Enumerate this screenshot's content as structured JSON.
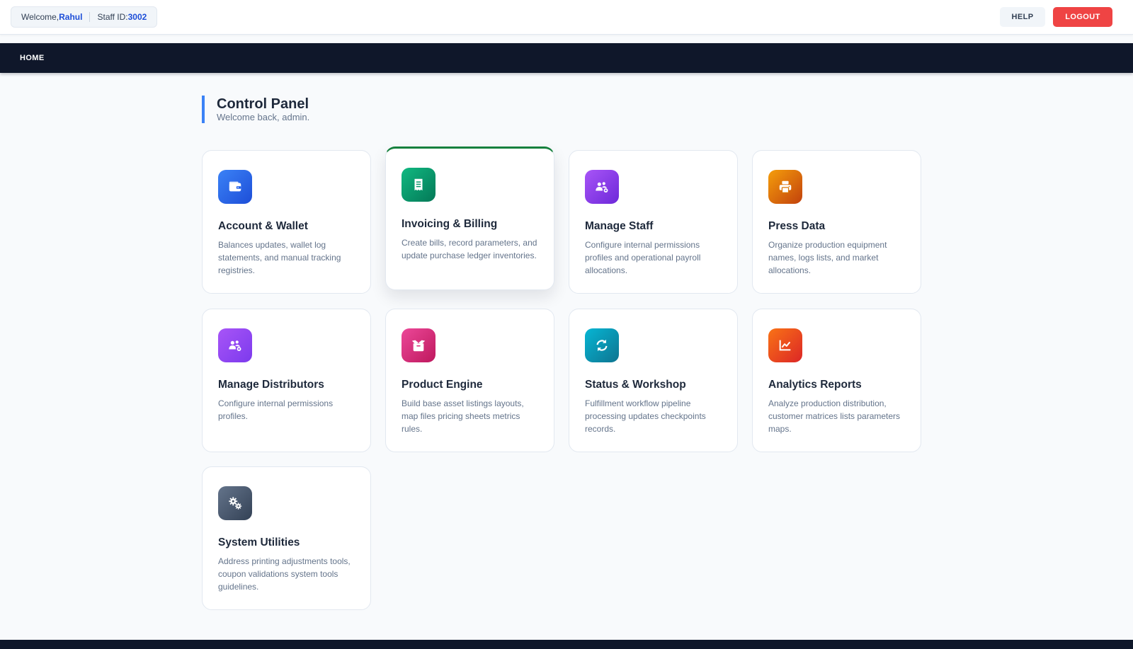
{
  "topbar": {
    "welcome_label": "Welcome, ",
    "user_name": "Rahul",
    "staff_label": "Staff ID: ",
    "staff_id": "3002",
    "help_label": "HELP",
    "logout_label": "LOGOUT"
  },
  "nav": {
    "home_label": "HOME"
  },
  "header": {
    "title": "Control Panel",
    "subtitle": "Welcome back, admin."
  },
  "cards": [
    {
      "title": "Account & Wallet",
      "desc": "Balances updates, wallet log statements, and manual tracking registries.",
      "icon": "wallet-icon",
      "color": "#2563eb"
    },
    {
      "title": "Invoicing & Billing",
      "desc": "Create bills, record parameters, and update purchase ledger inventories.",
      "icon": "receipt-icon",
      "color": "#059669"
    },
    {
      "title": "Manage Staff",
      "desc": "Configure internal permissions profiles and operational payroll allocations.",
      "icon": "users-gear-icon",
      "color": "#7c3aed"
    },
    {
      "title": "Press Data",
      "desc": "Organize production equipment names, logs lists, and market allocations.",
      "icon": "printer-icon",
      "color": "#d97706"
    },
    {
      "title": "Manage Distributors",
      "desc": "Configure internal permissions profiles.",
      "icon": "users-gear-icon",
      "color": "#7c3aed"
    },
    {
      "title": "Product Engine",
      "desc": "Build base asset listings layouts, map files pricing sheets metrics rules.",
      "icon": "box-open-icon",
      "color": "#db2777"
    },
    {
      "title": "Status & Workshop",
      "desc": "Fulfillment workflow pipeline processing updates checkpoints records.",
      "icon": "refresh-icon",
      "color": "#0891b2"
    },
    {
      "title": "Analytics Reports",
      "desc": "Analyze production distribution, customer matrices lists parameters maps.",
      "icon": "line-chart-icon",
      "color": "#ea580c"
    },
    {
      "title": "System Utilities",
      "desc": "Address printing adjustments tools, coupon validations system tools guidelines.",
      "icon": "gears-icon",
      "color": "#475569"
    }
  ]
}
